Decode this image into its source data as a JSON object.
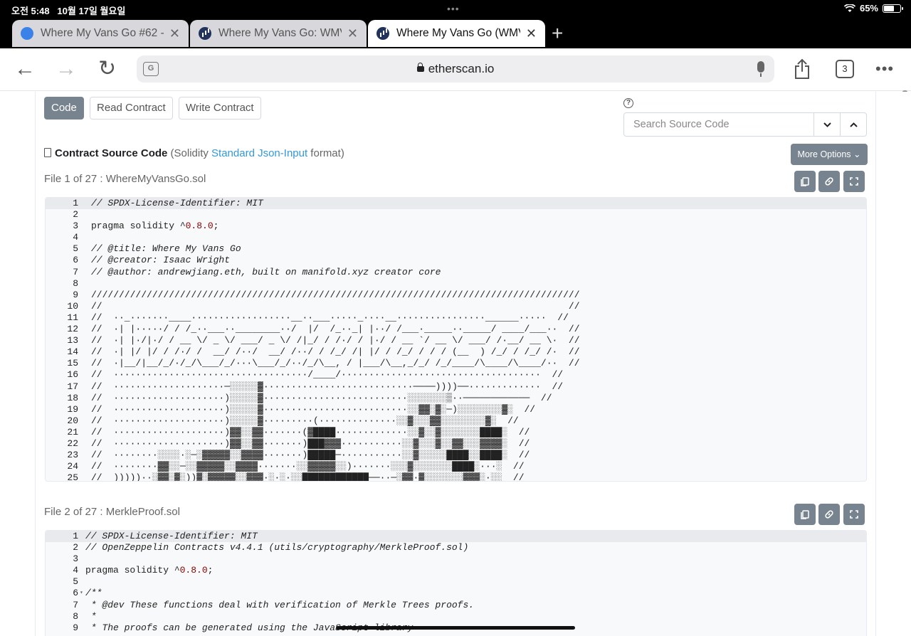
{
  "status": {
    "time": "오전 5:48",
    "date": "10월 17일 월요일",
    "battery": "65%",
    "battery_level": 0.65,
    "dots": "•••"
  },
  "tabs": [
    {
      "title": "Where My Vans Go #62 - ",
      "icon": "blue-circle-icon"
    },
    {
      "title": "Where My Vans Go: WMV",
      "icon": "etherscan-icon"
    },
    {
      "title": "Where My Vans Go (WMV",
      "icon": "etherscan-icon"
    }
  ],
  "toolbar": {
    "host": "etherscan.io",
    "tab_count": "3",
    "translate_glyph": "G",
    "new_tab": "+",
    "back": "←",
    "forward": "→",
    "reload": "↻",
    "more": "•••"
  },
  "contract": {
    "buttons": {
      "code": "Code",
      "read": "Read Contract",
      "write": "Write Contract"
    },
    "search_placeholder": "Search Source Code",
    "help": "?",
    "title_bold": "Contract Source Code",
    "title_pre": " (Solidity ",
    "title_link": "Standard Json-Input",
    "title_post": " format)",
    "more_options": "More Options ⌄"
  },
  "files": [
    {
      "label": "File 1 of 27 : WhereMyVansGo.sol",
      "lines": [
        {
          "n": "1",
          "t": "// SPDX-License-Identifier: MIT",
          "kind": "comment"
        },
        {
          "n": "2",
          "t": "",
          "kind": "plain"
        },
        {
          "n": "3",
          "t": "pragma solidity ^",
          "num": "0.8.0",
          "after": ";",
          "kind": "pragma"
        },
        {
          "n": "4",
          "t": "",
          "kind": "plain"
        },
        {
          "n": "5",
          "t": "// @title: Where My Vans Go",
          "kind": "comment"
        },
        {
          "n": "6",
          "t": "// @creator: Isaac Wright",
          "kind": "comment"
        },
        {
          "n": "7",
          "t": "// @author: andrewjiang.eth, built on manifold.xyz creator core",
          "kind": "comment"
        },
        {
          "n": "8",
          "t": "",
          "kind": "plain"
        },
        {
          "n": "9",
          "t": "////////////////////////////////////////////////////////////////////////////////////////",
          "kind": "plain"
        },
        {
          "n": "10",
          "t": "//                                                                                    //",
          "kind": "plain"
        },
        {
          "n": "11",
          "t": "//  ··_·······____··················__··___·····_····__················______·····  //",
          "kind": "plain"
        },
        {
          "n": "12",
          "t": "//  ·| |·····/ / /_··___··________··/  |/  /_··_| |··/ /___·_____··_____/ ____/___··  //",
          "kind": "plain"
        },
        {
          "n": "13",
          "t": "//  ·| |·/|·/ / __ \\/ _ \\/ ___/ _ \\/ /|_/ / /·/ / |·/ / __ `/ __ \\/ ___/ /·__/ __ \\·  //",
          "kind": "plain"
        },
        {
          "n": "14",
          "t": "//  ·| |/ |/ / /·/ /  __/ /··/  __/ /··/ / /_/ /| |/ / /_/ / / / (__  ) /_/ / /_/ /·  //",
          "kind": "plain"
        },
        {
          "n": "15",
          "t": "//  ·|__/|__/_/·/_/\\___/_/···\\___/_/··/_/\\__, / |___/\\__,_/_/ /_/____/\\____/\\____/··  //",
          "kind": "plain"
        },
        {
          "n": "16",
          "t": "//  ···································/____/····································  //",
          "kind": "plain"
        },
        {
          "n": "17",
          "t": "//  ····················─░░░░░▓···························────))))──·············  //",
          "kind": "plain"
        },
        {
          "n": "18",
          "t": "//  ····················)░░░░░▓··························░░░░░░░▒··────────────  //",
          "kind": "plain"
        },
        {
          "n": "19",
          "t": "//  ····················)░░░░░▓··························░░▓▓░▓░─)░░░░░░░░▓░  //",
          "kind": "plain"
        },
        {
          "n": "20",
          "t": "//  ····················)░░░░░▓·········(··············░░▓░░░▓▓░░░░░░░░▓░  //",
          "kind": "plain"
        },
        {
          "n": "21",
          "t": "//  ····················)▓▓░░▓▓·······(▓████·············░░▓░░▓░░░░░░░████░  //",
          "kind": "plain"
        },
        {
          "n": "22",
          "t": "//  ····················)▓▓░░▓▓·······)███▓▓▓···········░░▓░░░▓░░▓▓░░░▓▓▓▓░  //",
          "kind": "plain"
        },
        {
          "n": "23",
          "t": "//  ········░░░░·░─░▓▓▓▓▓░░▓▓▓▓·······)█████─···········░░▓░░░░░████░░████░  //",
          "kind": "plain"
        },
        {
          "n": "24",
          "t": "//  ········▓▓░░─░░▓▓▓▓▓░░▓▓▓▓·······░░▓▓▓▓▓░░)·······░░░▓░░░░░░░████░···░  //",
          "kind": "plain"
        },
        {
          "n": "25",
          "t": "//  )))))··░▓▓░▓░))▓░▓▓▓▓▓░░▓▓▓·░·░·░░████████████──··─░▓▓·▓░░░░░░░▓▓▓░·░░  //",
          "kind": "plain"
        }
      ]
    },
    {
      "label": "File 2 of 27 : MerkleProof.sol",
      "lines": [
        {
          "n": "1",
          "t": "// SPDX-License-Identifier: MIT",
          "kind": "comment"
        },
        {
          "n": "2",
          "t": "// OpenZeppelin Contracts v4.4.1 (utils/cryptography/MerkleProof.sol)",
          "kind": "comment"
        },
        {
          "n": "3",
          "t": "",
          "kind": "plain"
        },
        {
          "n": "4",
          "t": "pragma solidity ^",
          "num": "0.8.0",
          "after": ";",
          "kind": "pragma"
        },
        {
          "n": "5",
          "t": "",
          "kind": "plain"
        },
        {
          "n": "6",
          "t": "/**",
          "kind": "comment",
          "fold": "▾"
        },
        {
          "n": "7",
          "t": " * @dev These functions deal with verification of Merkle Trees proofs.",
          "kind": "comment"
        },
        {
          "n": "8",
          "t": " *",
          "kind": "comment"
        },
        {
          "n": "9",
          "t": " * The proofs can be generated using the JavaScript library",
          "kind": "comment"
        }
      ]
    }
  ]
}
